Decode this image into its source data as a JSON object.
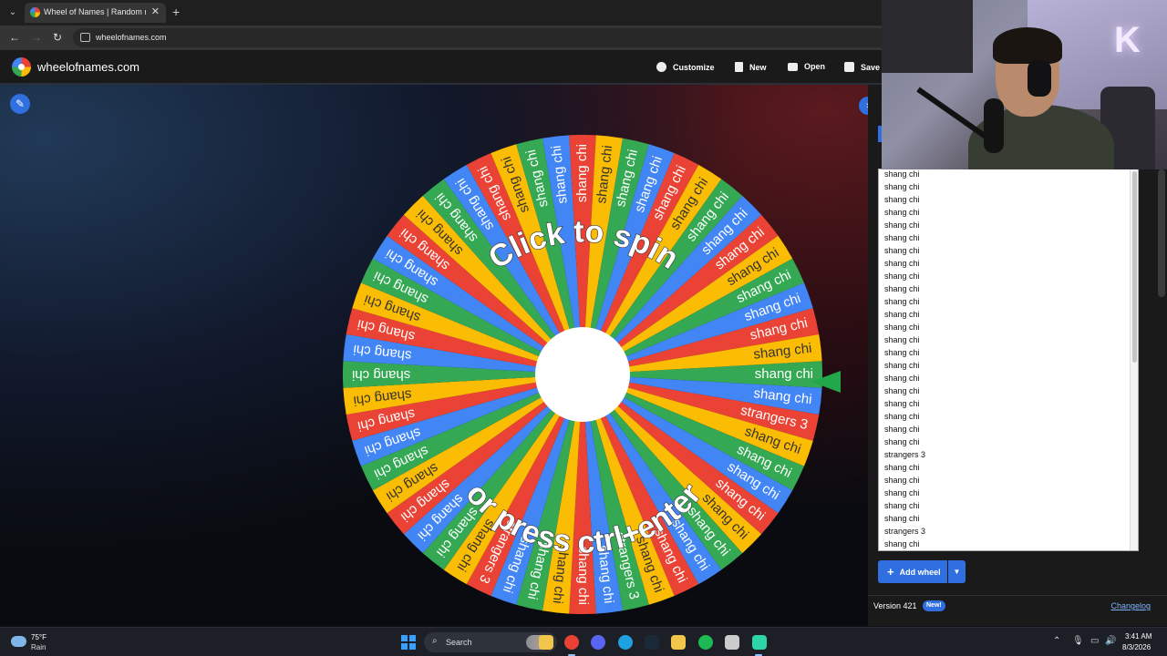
{
  "browser": {
    "tab_title": "Wheel of Names | Random nam",
    "url": "wheelofnames.com",
    "new_tab_symbol": "+",
    "close_symbol": "✕"
  },
  "header": {
    "logo": "wheelofnames.com",
    "customize": "Customize",
    "new": "New",
    "open": "Open",
    "save": "Save"
  },
  "wheel": {
    "prompt_top": "Click to spin",
    "prompt_bottom": "or press ctrl+enter",
    "segment_colors": [
      "#34a853",
      "#4285f4",
      "#ea4335",
      "#fbbc04"
    ],
    "pointer_color": "#22a84a",
    "labels": [
      "shang chi",
      "shang chi",
      "strangers 3",
      "shang chi",
      "shang chi",
      "shang chi",
      "shang chi",
      "shang chi",
      "shang chi",
      "shang chi",
      "shang chi",
      "shang chi",
      "strangers 3",
      "shang chi",
      "shang chi",
      "shang chi",
      "shang chi",
      "shang chi",
      "strangers 3",
      "shang chi",
      "shang chi",
      "shang chi",
      "shang chi",
      "shang chi",
      "shang chi",
      "shang chi",
      "shang chi",
      "shang chi",
      "shang chi",
      "shang chi",
      "shang chi",
      "shang chi",
      "shang chi",
      "shang chi",
      "shang chi",
      "shang chi",
      "shang chi",
      "shang chi",
      "shang chi",
      "shang chi",
      "shang chi",
      "shang chi",
      "shang chi",
      "shang chi",
      "shang chi",
      "shang chi",
      "shang chi",
      "shang chi",
      "shang chi",
      "shang chi",
      "shang chi",
      "shang chi",
      "shang chi",
      "shang chi",
      "shang chi",
      "shang chi"
    ]
  },
  "sidebar": {
    "entries": [
      "shang chi",
      "shang chi",
      "shang chi",
      "shang chi",
      "shang chi",
      "shang chi",
      "shang chi",
      "shang chi",
      "shang chi",
      "shang chi",
      "shang chi",
      "shang chi",
      "shang chi",
      "shang chi",
      "shang chi",
      "shang chi",
      "shang chi",
      "shang chi",
      "shang chi",
      "shang chi",
      "shang chi",
      "shang chi",
      "strangers 3",
      "shang chi",
      "shang chi",
      "shang chi",
      "shang chi",
      "shang chi",
      "strangers 3",
      "shang chi"
    ],
    "add_wheel": "Add wheel",
    "version": "Version 421",
    "new_badge": "New!",
    "changelog": "Changelog"
  },
  "taskbar": {
    "temperature": "75°F",
    "condition": "Rain",
    "search": "Search",
    "time": "3:41 AM",
    "date": "8/3/2026",
    "app_colors": [
      "#e94235",
      "#5865f2",
      "#1fa0e0",
      "#1b2838",
      "#f2c54b",
      "#1db954",
      "#cccccc",
      "#2dd4a8"
    ]
  }
}
